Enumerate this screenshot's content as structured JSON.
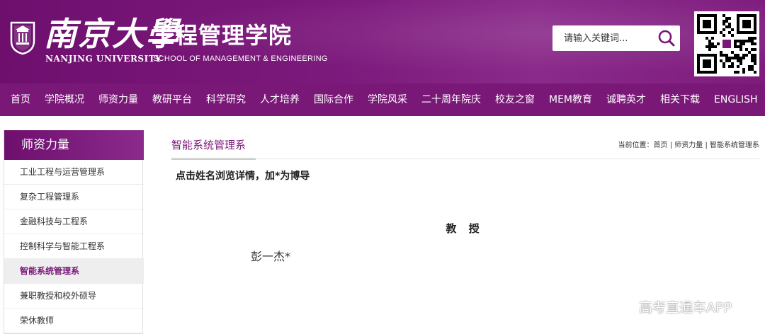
{
  "header": {
    "logo_cn": "南京大學",
    "school_cn": "工程管理学院",
    "university_en": "NANJING UNIVERSITY",
    "school_en": "SCHOOL OF MANAGEMENT & ENGINEERING",
    "search_placeholder": "请输入关键词...",
    "brand_color": "#7a1878"
  },
  "nav": {
    "items": [
      "首页",
      "学院概况",
      "师资力量",
      "教研平台",
      "科学研究",
      "人才培养",
      "国际合作",
      "学院风采",
      "二十周年院庆",
      "校友之窗",
      "MEM教育",
      "诚聘英才",
      "相关下载",
      "ENGLISH"
    ]
  },
  "sidebar": {
    "title": "师资力量",
    "items": [
      {
        "label": "工业工程与运营管理系",
        "active": false
      },
      {
        "label": "复杂工程管理系",
        "active": false
      },
      {
        "label": "金融科技与工程系",
        "active": false
      },
      {
        "label": "控制科学与智能工程系",
        "active": false
      },
      {
        "label": "智能系统管理系",
        "active": true
      },
      {
        "label": "兼职教授和校外硕导",
        "active": false
      },
      {
        "label": "荣休教师",
        "active": false
      }
    ]
  },
  "main": {
    "title": "智能系统管理系",
    "breadcrumb": {
      "prefix": "当前位置：",
      "items": [
        "首页",
        "师资力量",
        "智能系统管理系"
      ],
      "separator": " | "
    },
    "instruction": "点击姓名浏览详情，加*为博导",
    "rank_heading": "教 授",
    "people": [
      "彭一杰*"
    ]
  },
  "watermark": "高考直通车APP",
  "icons": {
    "search": "search-icon",
    "emblem": "university-emblem-icon",
    "qr": "qr-code-icon"
  }
}
